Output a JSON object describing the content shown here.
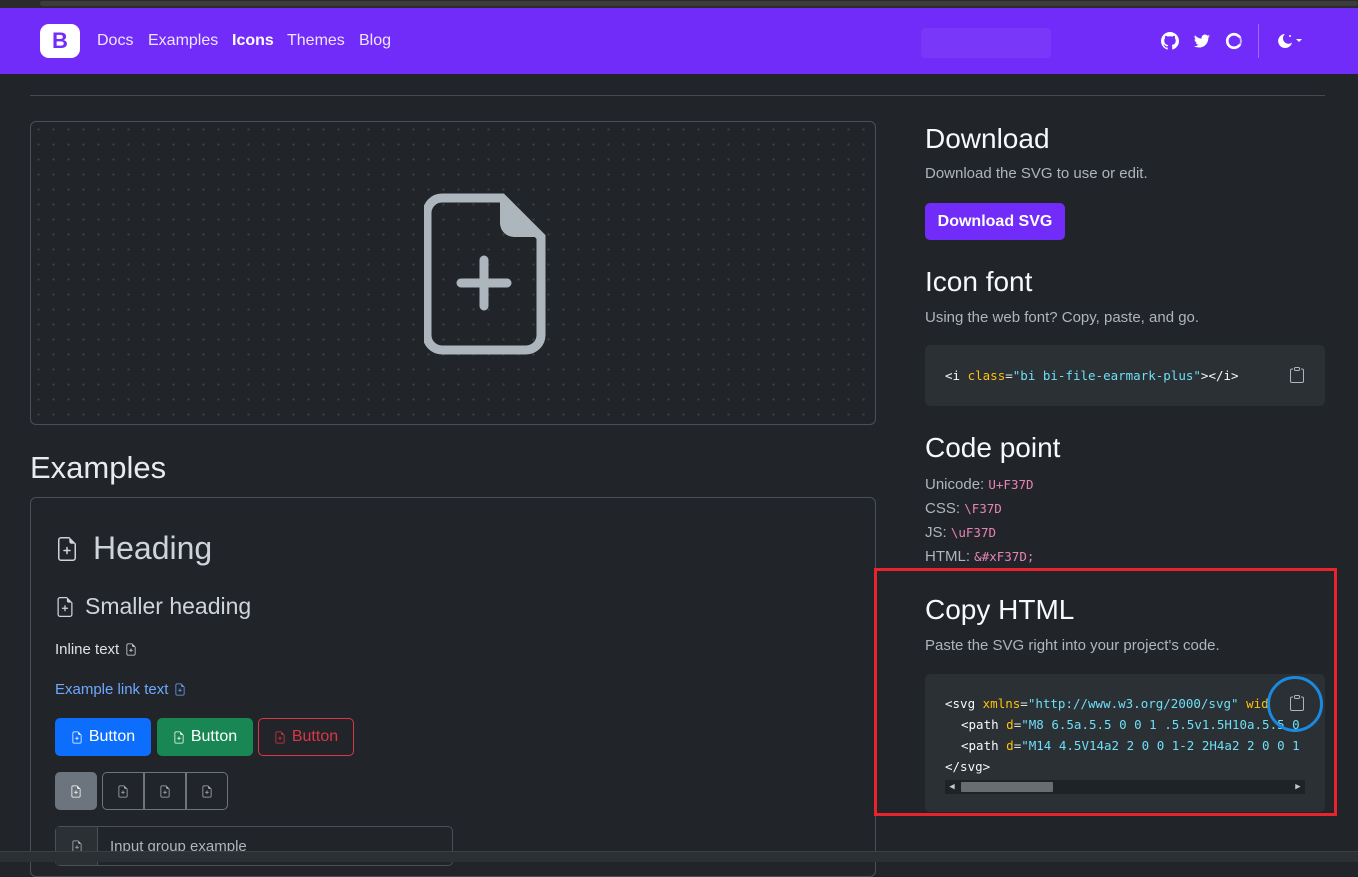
{
  "nav": {
    "brand": "B",
    "links": [
      "Docs",
      "Examples",
      "Icons",
      "Themes",
      "Blog"
    ],
    "active": "Icons",
    "icons": [
      "github-icon",
      "twitter-icon",
      "opencollective-icon",
      "theme-toggle-icon"
    ]
  },
  "preview": {
    "icon": "file-earmark-plus-icon"
  },
  "examples": {
    "title": "Examples",
    "heading": "Heading",
    "smaller_heading": "Smaller heading",
    "inline_text": "Inline text",
    "link_text": "Example link text",
    "buttons": [
      "Button",
      "Button",
      "Button"
    ],
    "input_placeholder": "Input group example"
  },
  "download": {
    "title": "Download",
    "desc": "Download the SVG to use or edit.",
    "button": "Download SVG"
  },
  "icon_font": {
    "title": "Icon font",
    "desc": "Using the web font? Copy, paste, and go.",
    "code_open": "<i",
    "code_attr": "class",
    "code_value": "\"bi bi-file-earmark-plus\"",
    "code_close": "></i>"
  },
  "code_point": {
    "title": "Code point",
    "rows": [
      {
        "label": "Unicode:",
        "value": "U+F37D"
      },
      {
        "label": "CSS:",
        "value": "\\F37D"
      },
      {
        "label": "JS:",
        "value": "\\uF37D"
      },
      {
        "label": "HTML:",
        "value": "&#xF37D;"
      }
    ]
  },
  "copy_html": {
    "title": "Copy HTML",
    "desc": "Paste the SVG right into your project's code.",
    "line1_tag": "<svg",
    "line1_attr": "xmlns",
    "line1_val": "\"http://www.w3.org/2000/svg\"",
    "line1_more": "wid",
    "line2_tag": "<path",
    "line2_attr": "d",
    "line2_val": "\"M8 6.5a.5.5 0 0 1 .5.5v1.5H10a.5.5 0",
    "line3_tag": "<path",
    "line3_attr": "d",
    "line3_val": "\"M14 4.5V14a2 2 0 0 1-2 2H4a2 2 0 0 1",
    "line4": "</svg>"
  },
  "colors": {
    "brand": "#712cf9",
    "highlight_red": "#e8232b",
    "highlight_blue": "#1a8ae0"
  }
}
